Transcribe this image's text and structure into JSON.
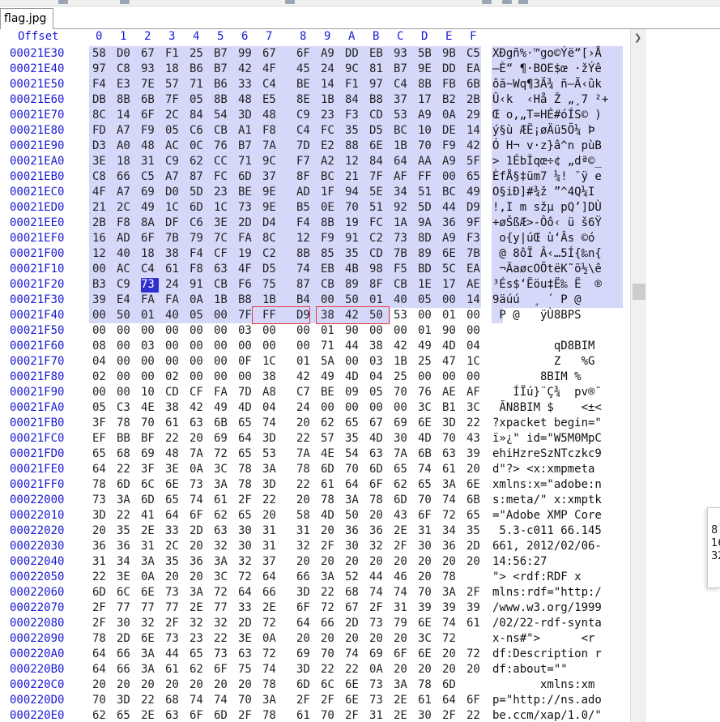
{
  "tab": {
    "title": "flag.jpg"
  },
  "header": {
    "offset_label": "Offset",
    "columns": [
      "0",
      "1",
      "2",
      "3",
      "4",
      "5",
      "6",
      "7",
      "8",
      "9",
      "A",
      "B",
      "C",
      "D",
      "E",
      "F"
    ]
  },
  "colors": {
    "accent": "#1a1ad8",
    "selection_bg": "#d6d8fa",
    "cursor": "#2f2fd0",
    "marker": "#e03c3c"
  },
  "rows": [
    {
      "offset": "00021E30",
      "bytes": [
        "58",
        "D0",
        "67",
        "F1",
        "25",
        "B7",
        "99",
        "67",
        "6F",
        "A9",
        "DD",
        "EB",
        "93",
        "5B",
        "9B",
        "C5"
      ],
      "ascii": "XÐgñ%·™go©Ýë“[›Å"
    },
    {
      "offset": "00021E40",
      "bytes": [
        "97",
        "C8",
        "93",
        "18",
        "B6",
        "B7",
        "42",
        "4F",
        "45",
        "24",
        "9C",
        "81",
        "B7",
        "9E",
        "DD",
        "EA"
      ],
      "ascii": "—È“ ¶·BOE$œ ·žÝê"
    },
    {
      "offset": "00021E50",
      "bytes": [
        "F4",
        "E3",
        "7E",
        "57",
        "71",
        "B6",
        "33",
        "C4",
        "BE",
        "14",
        "F1",
        "97",
        "C4",
        "8B",
        "FB",
        "6B"
      ],
      "ascii": "ôã~Wq¶3Ä¾ ñ—Ä‹ûk"
    },
    {
      "offset": "00021E60",
      "bytes": [
        "DB",
        "8B",
        "6B",
        "7F",
        "05",
        "8B",
        "48",
        "E5",
        "8E",
        "1B",
        "84",
        "B8",
        "37",
        "17",
        "B2",
        "2B"
      ],
      "ascii": "Û‹k  ‹Hå Ž „¸7 ²+"
    },
    {
      "offset": "00021E70",
      "bytes": [
        "8C",
        "14",
        "6F",
        "2C",
        "84",
        "54",
        "3D",
        "48",
        "C9",
        "23",
        "F3",
        "CD",
        "53",
        "A9",
        "0A",
        "29"
      ],
      "ascii": "Œ o,„T=HÉ#óÍS© )"
    },
    {
      "offset": "00021E80",
      "bytes": [
        "FD",
        "A7",
        "F9",
        "05",
        "C6",
        "CB",
        "A1",
        "F8",
        "C4",
        "FC",
        "35",
        "D5",
        "BC",
        "10",
        "DE",
        "14"
      ],
      "ascii": "ý§ù ÆË¡øÄü5Õ¼ Þ "
    },
    {
      "offset": "00021E90",
      "bytes": [
        "D3",
        "A0",
        "48",
        "AC",
        "0C",
        "76",
        "B7",
        "7A",
        "7D",
        "E2",
        "88",
        "6E",
        "1B",
        "70",
        "F9",
        "42"
      ],
      "ascii": "Ó H¬ v·z}â^n pùB"
    },
    {
      "offset": "00021EA0",
      "bytes": [
        "3E",
        "18",
        "31",
        "C9",
        "62",
        "CC",
        "71",
        "9C",
        "F7",
        "A2",
        "12",
        "84",
        "64",
        "AA",
        "A9",
        "5F"
      ],
      "ascii": "> 1ÉbÌqœ÷¢ „dª©_"
    },
    {
      "offset": "00021EB0",
      "bytes": [
        "C8",
        "66",
        "C5",
        "A7",
        "87",
        "FC",
        "6D",
        "37",
        "8F",
        "BC",
        "21",
        "7F",
        "AF",
        "FF",
        "00",
        "65"
      ],
      "ascii": "ÈfÅ§‡üm7 ¼! ¯ÿ e"
    },
    {
      "offset": "00021EC0",
      "bytes": [
        "4F",
        "A7",
        "69",
        "D0",
        "5D",
        "23",
        "BE",
        "9E",
        "AD",
        "1F",
        "94",
        "5E",
        "34",
        "51",
        "BC",
        "49"
      ],
      "ascii": "O§iÐ]#¾ž­ ”^4Q¼I"
    },
    {
      "offset": "00021ED0",
      "bytes": [
        "21",
        "2C",
        "49",
        "1C",
        "6D",
        "1C",
        "73",
        "9E",
        "B5",
        "0E",
        "70",
        "51",
        "92",
        "5D",
        "44",
        "D9"
      ],
      "ascii": "!,I m sžµ pQ’]DÙ"
    },
    {
      "offset": "00021EE0",
      "bytes": [
        "2B",
        "F8",
        "8A",
        "DF",
        "C6",
        "3E",
        "2D",
        "D4",
        "F4",
        "8B",
        "19",
        "FC",
        "1A",
        "9A",
        "36",
        "9F"
      ],
      "ascii": "+øŠßÆ>-Ôô‹ ü š6Ÿ"
    },
    {
      "offset": "00021EF0",
      "bytes": [
        "16",
        "AD",
        "6F",
        "7B",
        "79",
        "7C",
        "FA",
        "8C",
        "12",
        "F9",
        "91",
        "C2",
        "73",
        "8D",
        "A9",
        "F3"
      ],
      "ascii": " ­o{y|úŒ ù‘Âs ©ó"
    },
    {
      "offset": "00021F00",
      "bytes": [
        "12",
        "40",
        "18",
        "38",
        "F4",
        "CF",
        "19",
        "C2",
        "8B",
        "85",
        "35",
        "CD",
        "7B",
        "89",
        "6E",
        "7B"
      ],
      "ascii": " @ 8ôÏ Â‹…5Í{‰n{"
    },
    {
      "offset": "00021F10",
      "bytes": [
        "00",
        "AC",
        "C4",
        "61",
        "F8",
        "63",
        "4F",
        "D5",
        "74",
        "EB",
        "4B",
        "98",
        "F5",
        "BD",
        "5C",
        "EA"
      ],
      "ascii": " ¬ÄaøcOÕtëK˜õ½\\ê"
    },
    {
      "offset": "00021F20",
      "bytes": [
        "B3",
        "C9",
        "73",
        "24",
        "91",
        "CB",
        "F6",
        "75",
        "87",
        "CB",
        "89",
        "8F",
        "CB",
        "1E",
        "17",
        "AE"
      ],
      "ascii": "³És$‘Ëöu‡Ë‰ Ë  ®"
    },
    {
      "offset": "00021F30",
      "bytes": [
        "39",
        "E4",
        "FA",
        "FA",
        "0A",
        "1B",
        "B8",
        "1B",
        "B4",
        "00",
        "50",
        "01",
        "40",
        "05",
        "00",
        "14"
      ],
      "ascii": "9äúú  ¸ ´ P @   "
    },
    {
      "offset": "00021F40",
      "bytes": [
        "00",
        "50",
        "01",
        "40",
        "05",
        "00",
        "7F",
        "FF",
        "D9",
        "38",
        "42",
        "50",
        "53",
        "00",
        "01",
        "00"
      ],
      "ascii": " P @   ÿÙ8BPS   "
    },
    {
      "offset": "00021F50",
      "bytes": [
        "00",
        "00",
        "00",
        "00",
        "00",
        "00",
        "03",
        "00",
        "00",
        "01",
        "90",
        "00",
        "00",
        "01",
        "90",
        "00"
      ],
      "ascii": ""
    },
    {
      "offset": "00021F60",
      "bytes": [
        "08",
        "00",
        "03",
        "00",
        "00",
        "00",
        "00",
        "00",
        "00",
        "71",
        "44",
        "38",
        "42",
        "49",
        "4D",
        "04"
      ],
      "ascii": "         qD8BIM "
    },
    {
      "offset": "00021F70",
      "bytes": [
        "04",
        "00",
        "00",
        "00",
        "00",
        "00",
        "0F",
        "1C",
        "01",
        "5A",
        "00",
        "03",
        "1B",
        "25",
        "47",
        "1C"
      ],
      "ascii": "         Z   %G "
    },
    {
      "offset": "00021F80",
      "bytes": [
        "02",
        "00",
        "00",
        "02",
        "00",
        "00",
        "00",
        "38",
        "42",
        "49",
        "4D",
        "04",
        "25",
        "00",
        "00",
        "00"
      ],
      "ascii": "       8BIM %   "
    },
    {
      "offset": "00021F90",
      "bytes": [
        "00",
        "00",
        "10",
        "CD",
        "CF",
        "FA",
        "7D",
        "A8",
        "C7",
        "BE",
        "09",
        "05",
        "70",
        "76",
        "AE",
        "AF"
      ],
      "ascii": "   ÍÏú}¨Ç¾  pv®¯"
    },
    {
      "offset": "00021FA0",
      "bytes": [
        "05",
        "C3",
        "4E",
        "38",
        "42",
        "49",
        "4D",
        "04",
        "24",
        "00",
        "00",
        "00",
        "00",
        "3C",
        "B1",
        "3C"
      ],
      "ascii": " ÃN8BIM $    <±<"
    },
    {
      "offset": "00021FB0",
      "bytes": [
        "3F",
        "78",
        "70",
        "61",
        "63",
        "6B",
        "65",
        "74",
        "20",
        "62",
        "65",
        "67",
        "69",
        "6E",
        "3D",
        "22"
      ],
      "ascii": "?xpacket begin=\""
    },
    {
      "offset": "00021FC0",
      "bytes": [
        "EF",
        "BB",
        "BF",
        "22",
        "20",
        "69",
        "64",
        "3D",
        "22",
        "57",
        "35",
        "4D",
        "30",
        "4D",
        "70",
        "43"
      ],
      "ascii": "ï»¿\" id=\"W5M0MpC"
    },
    {
      "offset": "00021FD0",
      "bytes": [
        "65",
        "68",
        "69",
        "48",
        "7A",
        "72",
        "65",
        "53",
        "7A",
        "4E",
        "54",
        "63",
        "7A",
        "6B",
        "63",
        "39"
      ],
      "ascii": "ehiHzreSzNTczkc9"
    },
    {
      "offset": "00021FE0",
      "bytes": [
        "64",
        "22",
        "3F",
        "3E",
        "0A",
        "3C",
        "78",
        "3A",
        "78",
        "6D",
        "70",
        "6D",
        "65",
        "74",
        "61",
        "20"
      ],
      "ascii": "d\"?> <x:xmpmeta "
    },
    {
      "offset": "00021FF0",
      "bytes": [
        "78",
        "6D",
        "6C",
        "6E",
        "73",
        "3A",
        "78",
        "3D",
        "22",
        "61",
        "64",
        "6F",
        "62",
        "65",
        "3A",
        "6E"
      ],
      "ascii": "xmlns:x=\"adobe:n"
    },
    {
      "offset": "00022000",
      "bytes": [
        "73",
        "3A",
        "6D",
        "65",
        "74",
        "61",
        "2F",
        "22",
        "20",
        "78",
        "3A",
        "78",
        "6D",
        "70",
        "74",
        "6B"
      ],
      "ascii": "s:meta/\" x:xmptk"
    },
    {
      "offset": "00022010",
      "bytes": [
        "3D",
        "22",
        "41",
        "64",
        "6F",
        "62",
        "65",
        "20",
        "58",
        "4D",
        "50",
        "20",
        "43",
        "6F",
        "72",
        "65"
      ],
      "ascii": "=\"Adobe XMP Core"
    },
    {
      "offset": "00022020",
      "bytes": [
        "20",
        "35",
        "2E",
        "33",
        "2D",
        "63",
        "30",
        "31",
        "31",
        "20",
        "36",
        "36",
        "2E",
        "31",
        "34",
        "35"
      ],
      "ascii": " 5.3-c011 66.145"
    },
    {
      "offset": "00022030",
      "bytes": [
        "36",
        "36",
        "31",
        "2C",
        "20",
        "32",
        "30",
        "31",
        "32",
        "2F",
        "30",
        "32",
        "2F",
        "30",
        "36",
        "2D"
      ],
      "ascii": "661, 2012/02/06-"
    },
    {
      "offset": "00022040",
      "bytes": [
        "31",
        "34",
        "3A",
        "35",
        "36",
        "3A",
        "32",
        "37",
        "20",
        "20",
        "20",
        "20",
        "20",
        "20",
        "20",
        "20"
      ],
      "ascii": "14:56:27        "
    },
    {
      "offset": "00022050",
      "bytes": [
        "22",
        "3E",
        "0A",
        "20",
        "20",
        "3C",
        "72",
        "64",
        "66",
        "3A",
        "52",
        "44",
        "46",
        "20",
        "78"
      ],
      "ascii": "\"> <rdf:RDF x"
    },
    {
      "offset": "00022060",
      "bytes": [
        "6D",
        "6C",
        "6E",
        "73",
        "3A",
        "72",
        "64",
        "66",
        "3D",
        "22",
        "68",
        "74",
        "74",
        "70",
        "3A",
        "2F"
      ],
      "ascii": "mlns:rdf=\"http:/"
    },
    {
      "offset": "00022070",
      "bytes": [
        "2F",
        "77",
        "77",
        "77",
        "2E",
        "77",
        "33",
        "2E",
        "6F",
        "72",
        "67",
        "2F",
        "31",
        "39",
        "39",
        "39"
      ],
      "ascii": "/www.w3.org/1999"
    },
    {
      "offset": "00022080",
      "bytes": [
        "2F",
        "30",
        "32",
        "2F",
        "32",
        "32",
        "2D",
        "72",
        "64",
        "66",
        "2D",
        "73",
        "79",
        "6E",
        "74",
        "61"
      ],
      "ascii": "/02/22-rdf-synta"
    },
    {
      "offset": "00022090",
      "bytes": [
        "78",
        "2D",
        "6E",
        "73",
        "23",
        "22",
        "3E",
        "0A",
        "20",
        "20",
        "20",
        "20",
        "20",
        "3C",
        "72"
      ],
      "ascii": "x-ns#\">      <r"
    },
    {
      "offset": "000220A0",
      "bytes": [
        "64",
        "66",
        "3A",
        "44",
        "65",
        "73",
        "63",
        "72",
        "69",
        "70",
        "74",
        "69",
        "6F",
        "6E",
        "20",
        "72"
      ],
      "ascii": "df:Description r"
    },
    {
      "offset": "000220B0",
      "bytes": [
        "64",
        "66",
        "3A",
        "61",
        "62",
        "6F",
        "75",
        "74",
        "3D",
        "22",
        "22",
        "0A",
        "20",
        "20",
        "20",
        "20"
      ],
      "ascii": "df:about=\"\"     "
    },
    {
      "offset": "000220C0",
      "bytes": [
        "20",
        "20",
        "20",
        "20",
        "20",
        "20",
        "20",
        "78",
        "6D",
        "6C",
        "6E",
        "73",
        "3A",
        "78",
        "6D"
      ],
      "ascii": "       xmlns:xm"
    },
    {
      "offset": "000220D0",
      "bytes": [
        "70",
        "3D",
        "22",
        "68",
        "74",
        "74",
        "70",
        "3A",
        "2F",
        "2F",
        "6E",
        "73",
        "2E",
        "61",
        "64",
        "6F"
      ],
      "ascii": "p=\"http://ns.ado"
    },
    {
      "offset": "000220E0",
      "bytes": [
        "62",
        "65",
        "2E",
        "63",
        "6F",
        "6D",
        "2F",
        "78",
        "61",
        "70",
        "2F",
        "31",
        "2E",
        "30",
        "2F",
        "22"
      ],
      "ascii": "be.ccm/xap/1.0/\""
    }
  ],
  "popup": {
    "lines": [
      "",
      "8",
      "16",
      "32"
    ]
  }
}
